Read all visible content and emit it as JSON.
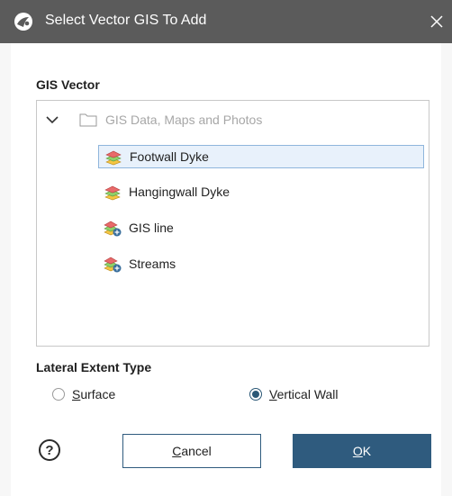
{
  "window": {
    "title": "Select Vector GIS To Add",
    "close_glyph": "✕",
    "app_icon": "leapfrog-app-icon"
  },
  "gis_vector": {
    "label": "GIS Vector",
    "root": {
      "label": "GIS Data, Maps and Photos",
      "icon": "folder-icon",
      "expanded": true
    },
    "items": [
      {
        "label": "Footwall Dyke",
        "icon": "polygon-layer-icon",
        "selected": true
      },
      {
        "label": "Hangingwall Dyke",
        "icon": "polygon-layer-icon",
        "selected": false
      },
      {
        "label": "GIS line",
        "icon": "line-layer-icon",
        "selected": false
      },
      {
        "label": "Streams",
        "icon": "line-layer-icon",
        "selected": false
      }
    ]
  },
  "lateral_extent": {
    "label": "Lateral Extent Type",
    "options": [
      {
        "mnemonic": "S",
        "rest": "urface",
        "checked": false
      },
      {
        "mnemonic": "V",
        "rest": "ertical Wall",
        "checked": true
      }
    ]
  },
  "footer": {
    "help_glyph": "?",
    "cancel": {
      "mnemonic": "C",
      "rest": "ancel"
    },
    "ok": {
      "mnemonic": "O",
      "rest": "K"
    }
  },
  "colors": {
    "titlebar": "#5b5b5b",
    "accent": "#2f5b7e",
    "selection_bg": "#e8f1fb",
    "selection_border": "#8fb6dc"
  }
}
